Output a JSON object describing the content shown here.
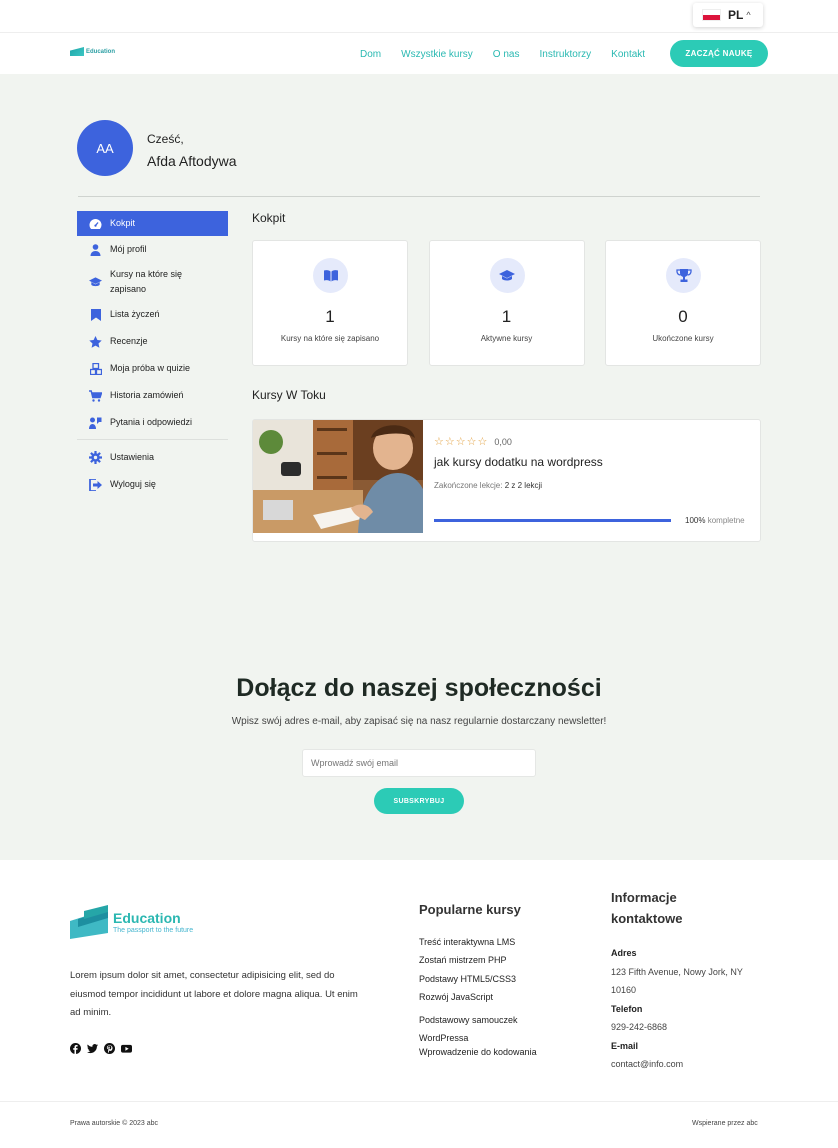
{
  "language": {
    "code": "PL",
    "caret": "^"
  },
  "header": {
    "logo_text": "Education",
    "nav": [
      "Dom",
      "Wszystkie kursy",
      "O nas",
      "Instruktorzy",
      "Kontakt"
    ],
    "cta": "ZACZĄĆ NAUKĘ"
  },
  "profile": {
    "initials": "AA",
    "greeting": "Cześć,",
    "name": "Afda Aftodywa"
  },
  "sidebar": {
    "items": [
      {
        "label": "Kokpit",
        "icon": "dashboard-icon",
        "active": true
      },
      {
        "label": "Mój profil",
        "icon": "user-icon"
      },
      {
        "label": "Kursy na które się zapisano",
        "icon": "graduation-cap-icon"
      },
      {
        "label": "Lista życzeń",
        "icon": "bookmark-icon"
      },
      {
        "label": "Recenzje",
        "icon": "star-icon"
      },
      {
        "label": "Moja próba w quizie",
        "icon": "cubes-icon"
      },
      {
        "label": "Historia zamówień",
        "icon": "cart-icon"
      },
      {
        "label": "Pytania i odpowiedzi",
        "icon": "question-icon"
      },
      {
        "label": "Ustawienia",
        "icon": "gear-icon"
      },
      {
        "label": "Wyloguj się",
        "icon": "logout-icon"
      }
    ]
  },
  "dashboard": {
    "title": "Kokpit",
    "stats": [
      {
        "value": "1",
        "label": "Kursy na które się zapisano",
        "icon": "book-icon"
      },
      {
        "value": "1",
        "label": "Aktywne kursy",
        "icon": "graduation-cap-icon"
      },
      {
        "value": "0",
        "label": "Ukończone kursy",
        "icon": "trophy-icon"
      }
    ],
    "in_progress_title": "Kursy W Toku",
    "course": {
      "rating": "0,00",
      "title": "jak kursy dodatku na wordpress",
      "lessons_label": "Zakończone lekcje:",
      "lessons_value": "2 z 2 lekcji",
      "progress_percent": 100,
      "progress_value": "100%",
      "progress_suffix": "kompletne"
    }
  },
  "newsletter": {
    "title": "Dołącz do naszej społeczności",
    "subtitle": "Wpisz swój adres e-mail, aby zapisać się na nasz regularnie dostarczany newsletter!",
    "placeholder": "Wprowadź swój email",
    "button": "SUBSKRYBUJ"
  },
  "footer": {
    "logo_text": "Education",
    "tagline": "The passport to the future",
    "description": "Lorem ipsum dolor sit amet, consectetur adipisicing elit, sed do eiusmod tempor incididunt ut labore et dolore magna aliqua. Ut enim ad minim.",
    "social": [
      "facebook-icon",
      "twitter-icon",
      "pinterest-icon",
      "youtube-icon"
    ],
    "popular_title": "Popularne kursy",
    "popular": [
      "Treść interaktywna LMS",
      "Zostań mistrzem PHP",
      "Podstawy HTML5/CSS3",
      "Rozwój JavaScript",
      "Podstawowy samouczek WordPressa",
      "Wprowadzenie do kodowania"
    ],
    "contact_title": "Informacje kontaktowe",
    "address_label": "Adres",
    "address": "123 Fifth Avenue, Nowy Jork, NY 10160",
    "phone_label": "Telefon",
    "phone": "929-242-6868",
    "email_label": "E-mail",
    "email": "contact@info.com",
    "copyright": "Prawa autorskie © 2023 abc",
    "powered": "Wspierane przez abc"
  },
  "colors": {
    "accent": "#2ccbb6",
    "primary": "#3d63dd",
    "background": "#f1f4f0"
  }
}
